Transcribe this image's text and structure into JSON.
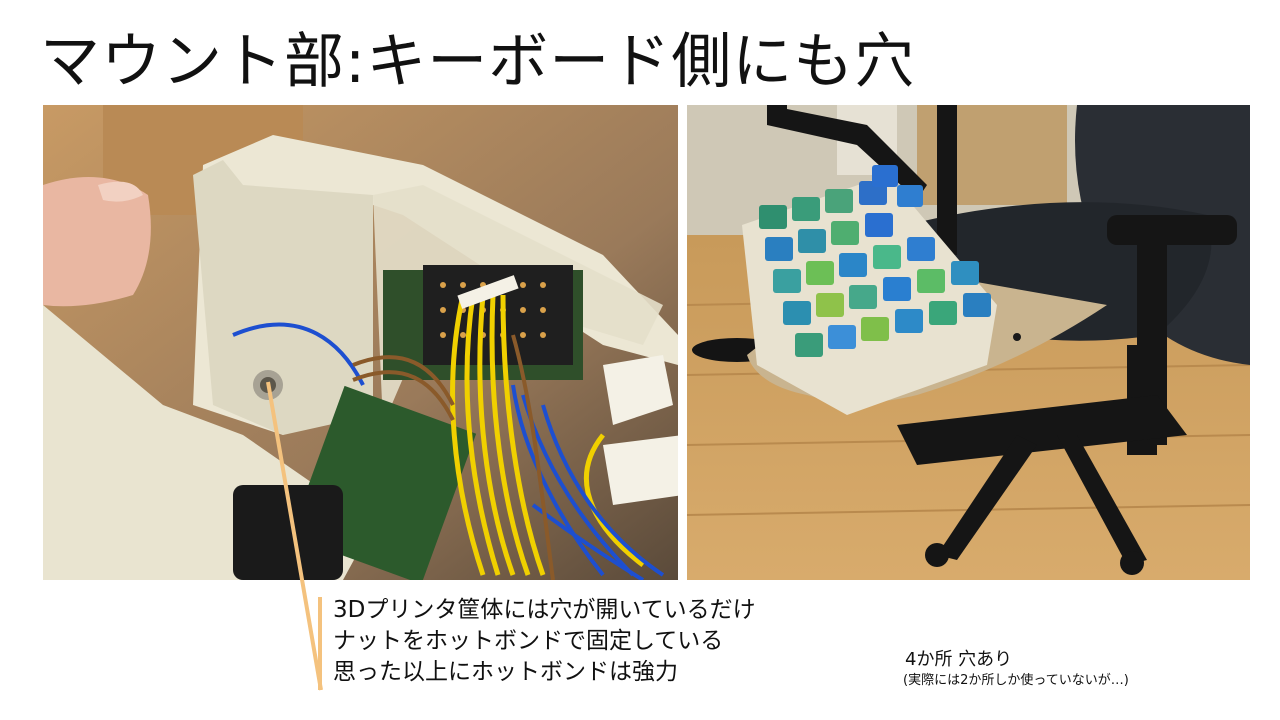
{
  "slide": {
    "title": "マウント部:キーボード側にも穴",
    "callout": {
      "lines": [
        "3Dプリンタ筐体には穴が開いているだけ",
        "ナットをホットボンドで固定している",
        "思った以上にホットボンドは強力"
      ]
    },
    "note": {
      "main": "4か所  穴あり",
      "sub": "(実際には2か所しか使っていないが…)"
    }
  },
  "colors": {
    "callout_accent": "#f4c27e"
  }
}
